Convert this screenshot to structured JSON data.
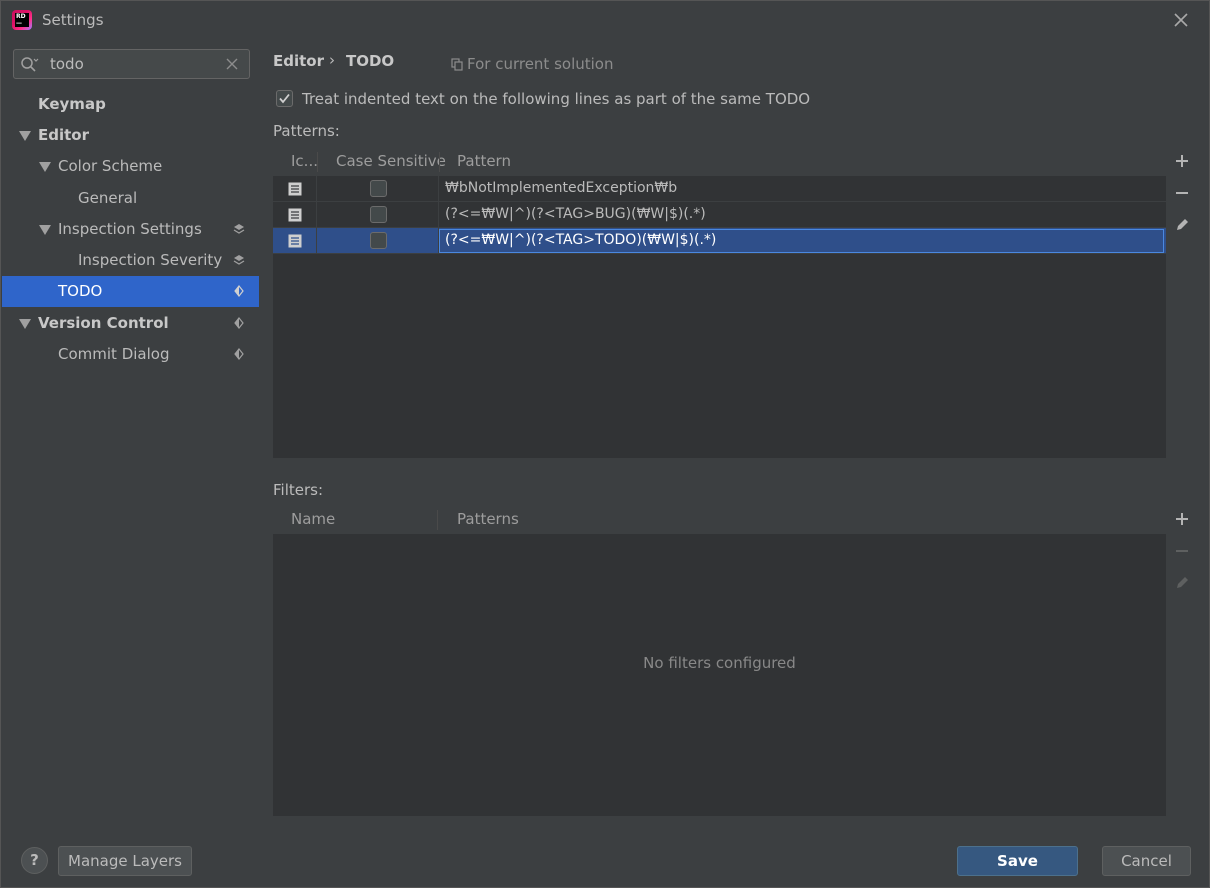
{
  "window": {
    "title": "Settings"
  },
  "search": {
    "value": "todo"
  },
  "sidebar": {
    "items": [
      {
        "label": "Keymap"
      },
      {
        "label": "Editor"
      },
      {
        "label": "Color Scheme"
      },
      {
        "label": "General"
      },
      {
        "label": "Inspection Settings"
      },
      {
        "label": "Inspection Severity"
      },
      {
        "label": "TODO"
      },
      {
        "label": "Version Control"
      },
      {
        "label": "Commit Dialog"
      }
    ]
  },
  "breadcrumb": {
    "parent": "Editor",
    "separator": "›",
    "current": "TODO"
  },
  "scope": {
    "label": "For current solution"
  },
  "options": {
    "treat_indented": "Treat indented text on the following lines as part of the same TODO",
    "treat_indented_checked": true
  },
  "patterns": {
    "label": "Patterns:",
    "columns": [
      "Ic...",
      "Case Sensitive",
      "Pattern"
    ],
    "rows": [
      {
        "case_sensitive": false,
        "pattern": "₩bNotImplementedException₩b"
      },
      {
        "case_sensitive": false,
        "pattern": "(?<=₩W|^)(?<TAG>BUG)(₩W|$)(.*)"
      },
      {
        "case_sensitive": false,
        "pattern": "(?<=₩W|^)(?<TAG>TODO)(₩W|$)(.*)"
      }
    ],
    "selected_row": 2
  },
  "filters": {
    "label": "Filters:",
    "columns": [
      "Name",
      "Patterns"
    ],
    "empty_text": "No filters configured"
  },
  "footer": {
    "help_label": "?",
    "manage_layers_label": "Manage Layers",
    "save_label": "Save",
    "cancel_label": "Cancel"
  },
  "colors": {
    "background": "#3c3f41",
    "selection": "#2f65ca",
    "primary_button": "#365880"
  },
  "icons": [
    "app-logo",
    "close-icon",
    "search-icon",
    "clear-icon",
    "layer-icon",
    "copy-icon",
    "checkmark-icon",
    "document-icon",
    "plus-icon",
    "minus-icon",
    "edit-icon",
    "help-icon"
  ]
}
